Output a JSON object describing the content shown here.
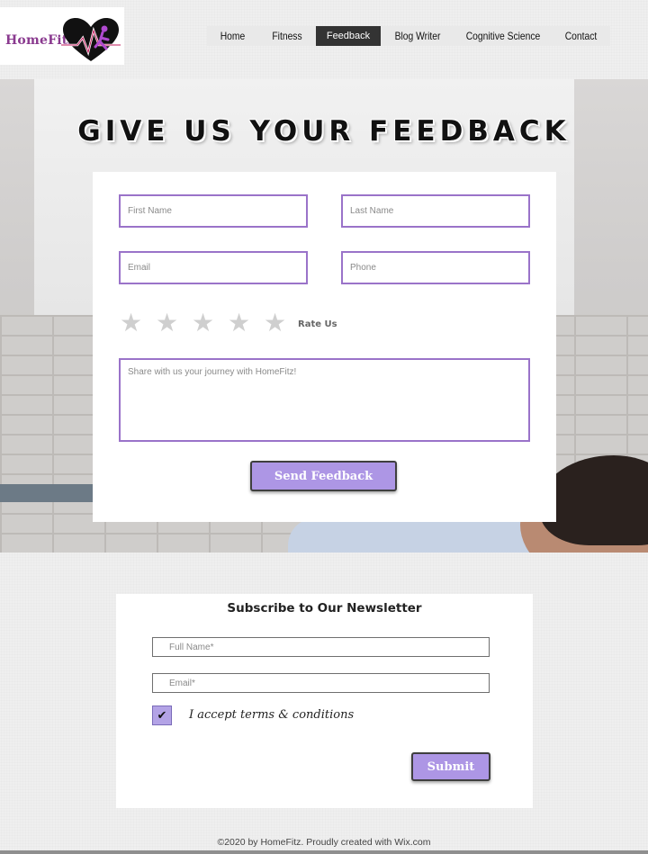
{
  "header": {
    "logo_text": "HomeFitz",
    "nav": [
      {
        "label": "Home",
        "active": false
      },
      {
        "label": "Fitness",
        "active": false
      },
      {
        "label": "Feedback",
        "active": true
      },
      {
        "label": "Blog Writer",
        "active": false
      },
      {
        "label": "Cognitive Science",
        "active": false
      },
      {
        "label": "Contact",
        "active": false
      }
    ]
  },
  "hero": {
    "title": "GIVE US YOUR FEEDBACK"
  },
  "feedback_form": {
    "first_name_placeholder": "First Name",
    "last_name_placeholder": "Last Name",
    "email_placeholder": "Email",
    "phone_placeholder": "Phone",
    "stars": [
      "★",
      "★",
      "★",
      "★",
      "★"
    ],
    "rating_label": "Rate Us",
    "message_placeholder": "Share with us your journey with HomeFitz!",
    "submit_label": "Send Feedback"
  },
  "newsletter": {
    "title": "Subscribe to Our Newsletter",
    "full_name_placeholder": "Full Name*",
    "email_placeholder": "Email*",
    "terms_checked": true,
    "check_glyph": "✔",
    "terms_label": "I accept terms & conditions",
    "submit_label": "Submit"
  },
  "footer": {
    "text": "©2020 by HomeFitz. Proudly created with Wix.com"
  },
  "colors": {
    "accent": "#ad96e5",
    "input_border": "#9a73c9",
    "nav_active_bg": "#333333",
    "brand_purple": "#8a3a8f"
  }
}
